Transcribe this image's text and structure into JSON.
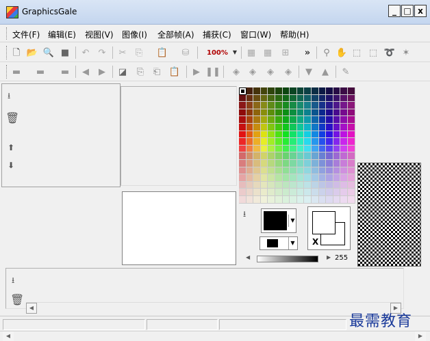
{
  "window": {
    "title": "GraphicsGale",
    "controls": {
      "minimize": "_",
      "maximize": "□",
      "close": "x"
    }
  },
  "menu": {
    "items": [
      {
        "label": "文件(F)"
      },
      {
        "label": "编辑(E)"
      },
      {
        "label": "视图(V)"
      },
      {
        "label": "图像(I)"
      },
      {
        "label": "全部帧(A)"
      },
      {
        "label": "捕获(C)"
      },
      {
        "label": "窗口(W)"
      },
      {
        "label": "帮助(H)"
      }
    ]
  },
  "toolbar1": {
    "zoom_label": "100%",
    "overflow": "»"
  },
  "color_panel": {
    "swap_label": "X",
    "alpha_value": "255"
  },
  "watermark": "最需教育",
  "colors": {
    "titlebar": "#c4d6ef",
    "zoom_text": "#b00000",
    "watermark": "#1a3a9a"
  }
}
